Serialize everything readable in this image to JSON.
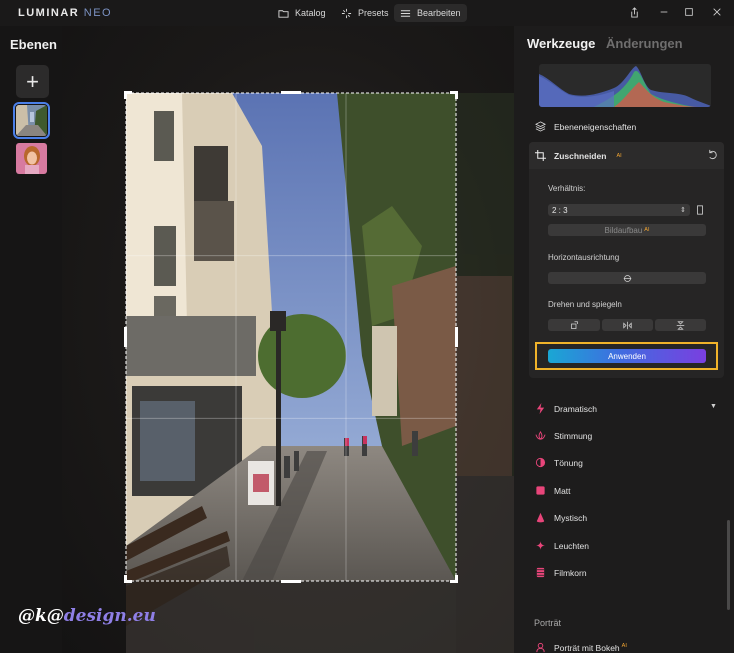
{
  "app": {
    "logo_main": "LUMINAR",
    "logo_accent": "NEO"
  },
  "nav": {
    "tabs": [
      {
        "label": "Katalog"
      },
      {
        "label": "Presets"
      },
      {
        "label": "Bearbeiten"
      }
    ]
  },
  "left_panel": {
    "title": "Ebenen"
  },
  "right_panel": {
    "tab_tools": "Werkzeuge",
    "tab_changes": "Änderungen",
    "layer_properties": "Ebeneneigenschaften",
    "crop": {
      "title": "Zuschneiden",
      "ai_badge": "AI",
      "ratio_label": "Verhältnis:",
      "ratio_value": "2 : 3",
      "composition_button": "Bildaufbau",
      "horizon_label": "Horizontausrichtung",
      "rotate_label": "Drehen und spiegeln",
      "apply_button": "Anwenden"
    },
    "tools": [
      {
        "label": "Dramatisch",
        "icon": "lightning-icon"
      },
      {
        "label": "Stimmung",
        "icon": "lotus-icon"
      },
      {
        "label": "Tönung",
        "icon": "toning-icon"
      },
      {
        "label": "Matt",
        "icon": "square-icon"
      },
      {
        "label": "Mystisch",
        "icon": "cone-icon"
      },
      {
        "label": "Leuchten",
        "icon": "glow-icon"
      },
      {
        "label": "Filmkorn",
        "icon": "film-icon"
      }
    ],
    "portrait_section": "Porträt",
    "portrait_bokeh": "Porträt mit Bokeh",
    "portrait_bokeh_ai": "AI"
  },
  "colors": {
    "accent_blue": "#4a7fe8",
    "apply_start": "#1aa7d4",
    "apply_end": "#7a3fe0",
    "highlight": "#f0b32a",
    "tool_icon": "#e8457a"
  },
  "watermark": {
    "prefix": "@k@",
    "suffix": "design.eu"
  }
}
